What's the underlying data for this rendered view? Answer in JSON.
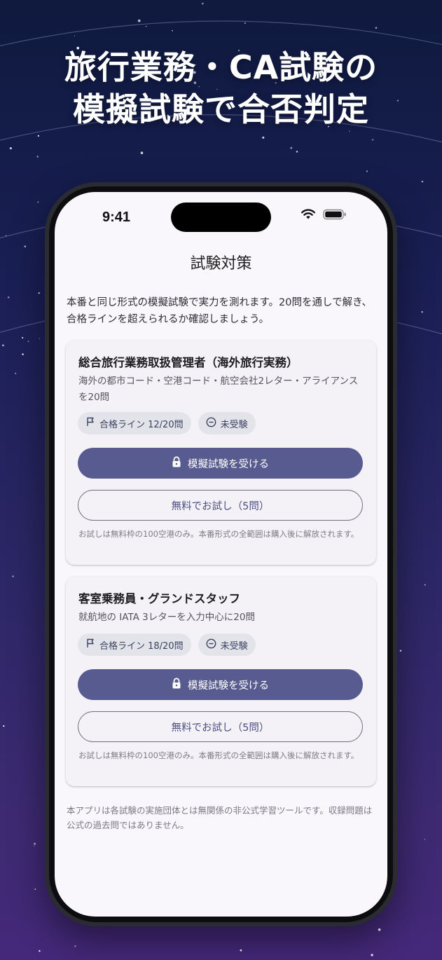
{
  "headline": {
    "line1": "旅行業務・CA試験の",
    "line2": "模擬試験で合否判定"
  },
  "status_bar": {
    "time": "9:41",
    "icons": [
      "wifi-icon",
      "battery-icon"
    ]
  },
  "screen": {
    "title": "試験対策",
    "intro": "本番と同じ形式の模擬試験で実力を測れます。20問を通しで解き、合格ラインを超えられるか確認しましょう。",
    "disclaimer": "本アプリは各試験の実施団体とは無関係の非公式学習ツールです。収録問題は公式の過去問ではありません。"
  },
  "exams": [
    {
      "title": "総合旅行業務取扱管理者（海外旅行実務）",
      "description": "海外の都市コード・空港コード・航空会社2レター・アライアンスを20問",
      "pass_line_chip": "合格ライン 12/20問",
      "status_chip": "未受験",
      "primary_button": "模擬試験を受ける",
      "trial_button": "無料でお試し（5問）",
      "note": "お試しは無料枠の100空港のみ。本番形式の全範囲は購入後に解放されます。"
    },
    {
      "title": "客室乗務員・グランドスタッフ",
      "description": "就航地の IATA 3レターを入力中心に20問",
      "pass_line_chip": "合格ライン 18/20問",
      "status_chip": "未受験",
      "primary_button": "模擬試験を受ける",
      "trial_button": "無料でお試し（5問）",
      "note": "お試しは無料枠の100空港のみ。本番形式の全範囲は購入後に解放されます。"
    }
  ],
  "colors": {
    "background_top": "#0f1a3e",
    "background_bottom": "#45287a",
    "primary_button": "#575b8f",
    "chip_bg": "#e3e4ea",
    "screen_bg": "#f9f6fc"
  }
}
